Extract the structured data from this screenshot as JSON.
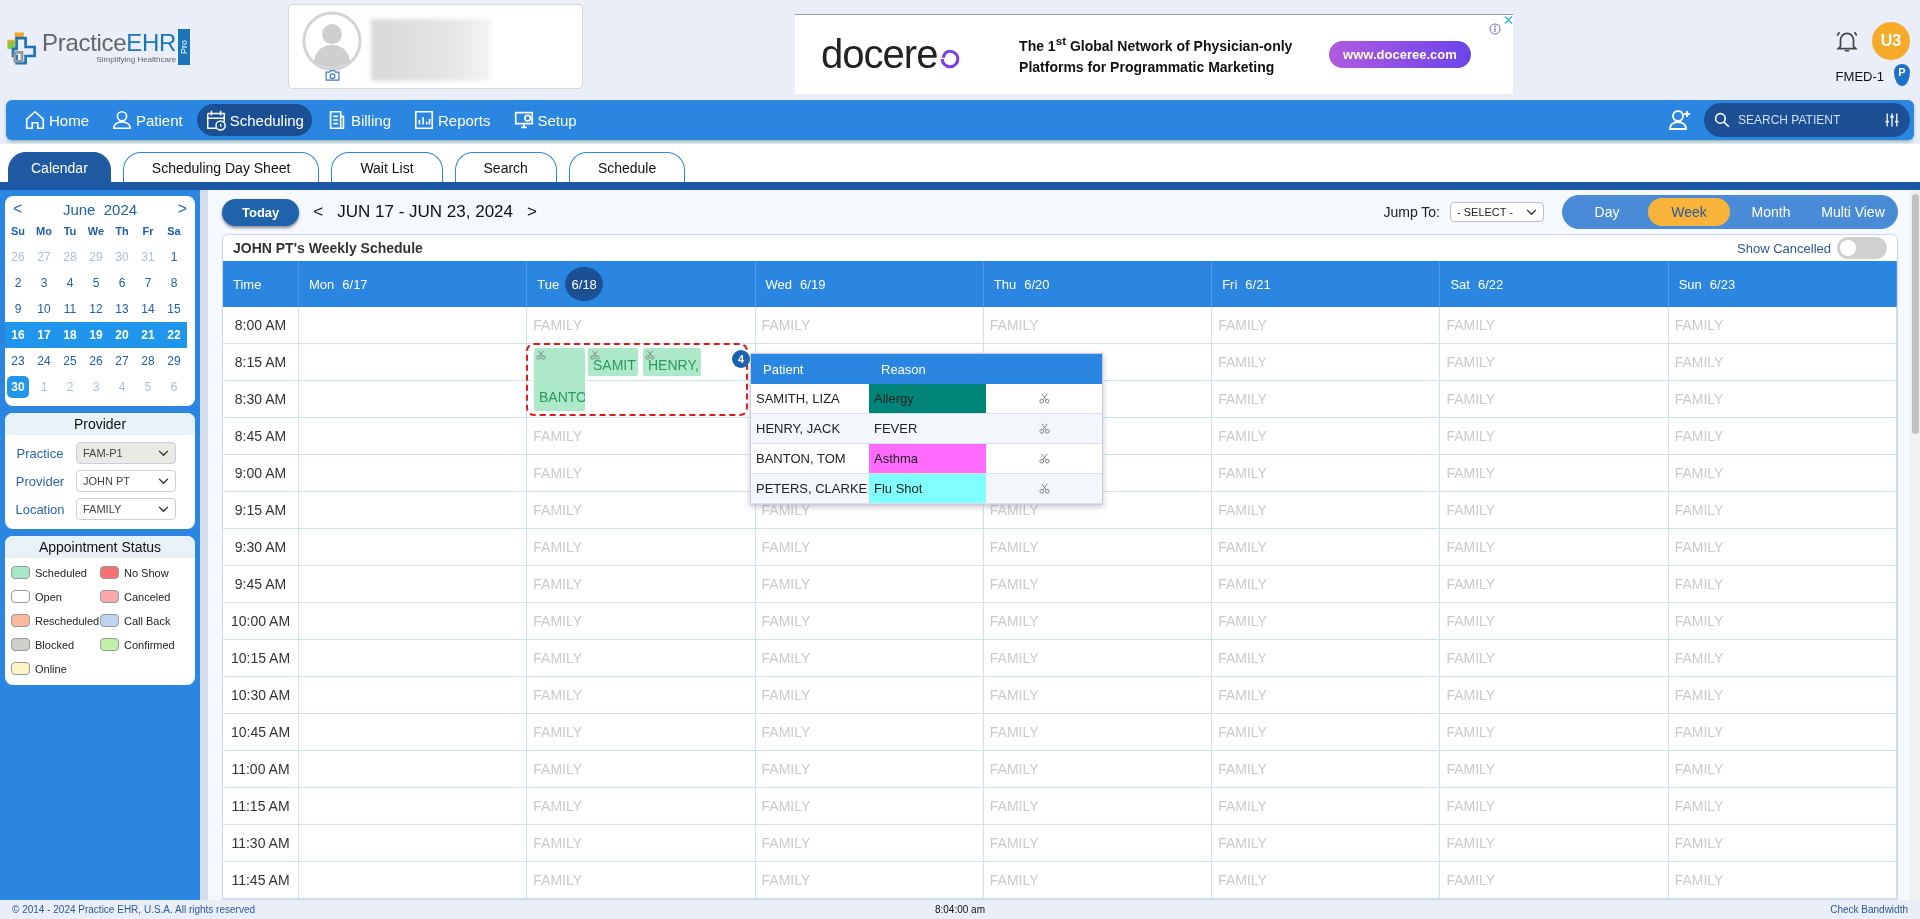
{
  "logo": {
    "name_a": "Practice",
    "name_b": "EHR",
    "tagline": "Simplifying Healthcare",
    "edition": "Pro"
  },
  "ad": {
    "brand": "docere",
    "headline": "The 1$^{st}$ Global Network of Physician-only",
    "headline2": "Platforms for Programmatic Marketing",
    "url": "www.doceree.com"
  },
  "user": {
    "initials": "U3",
    "facility": "FMED-1",
    "pin_letter": "P"
  },
  "nav": [
    {
      "label": "Home",
      "selected": false
    },
    {
      "label": "Patient",
      "selected": false
    },
    {
      "label": "Scheduling",
      "selected": true
    },
    {
      "label": "Billing",
      "selected": false
    },
    {
      "label": "Reports",
      "selected": false
    },
    {
      "label": "Setup",
      "selected": false
    }
  ],
  "search": {
    "placeholder": "SEARCH PATIENT"
  },
  "tabs": [
    {
      "label": "Calendar",
      "selected": true
    },
    {
      "label": "Scheduling Day Sheet",
      "selected": false
    },
    {
      "label": "Wait List",
      "selected": false
    },
    {
      "label": "Search",
      "selected": false
    },
    {
      "label": "Schedule",
      "selected": false
    }
  ],
  "mini_calendar": {
    "prev": "<",
    "month": "June",
    "year": "2024",
    "next": ">",
    "weekdays": [
      "Su",
      "Mo",
      "Tu",
      "We",
      "Th",
      "Fr",
      "Sa"
    ],
    "weeks": [
      {
        "selected": false,
        "days": [
          {
            "d": "26",
            "muted": true,
            "selected": false
          },
          {
            "d": "27",
            "muted": true,
            "selected": false
          },
          {
            "d": "28",
            "muted": true,
            "selected": false
          },
          {
            "d": "29",
            "muted": true,
            "selected": false
          },
          {
            "d": "30",
            "muted": true,
            "selected": false
          },
          {
            "d": "31",
            "muted": true,
            "selected": false
          },
          {
            "d": "1",
            "muted": false,
            "selected": false
          }
        ]
      },
      {
        "selected": false,
        "days": [
          {
            "d": "2",
            "muted": false,
            "selected": false
          },
          {
            "d": "3",
            "muted": false,
            "selected": false
          },
          {
            "d": "4",
            "muted": false,
            "selected": false
          },
          {
            "d": "5",
            "muted": false,
            "selected": false
          },
          {
            "d": "6",
            "muted": false,
            "selected": false
          },
          {
            "d": "7",
            "muted": false,
            "selected": false
          },
          {
            "d": "8",
            "muted": false,
            "selected": false
          }
        ]
      },
      {
        "selected": false,
        "days": [
          {
            "d": "9",
            "muted": false,
            "selected": false
          },
          {
            "d": "10",
            "muted": false,
            "selected": false
          },
          {
            "d": "11",
            "muted": false,
            "selected": false
          },
          {
            "d": "12",
            "muted": false,
            "selected": false
          },
          {
            "d": "13",
            "muted": false,
            "selected": false
          },
          {
            "d": "14",
            "muted": false,
            "selected": false
          },
          {
            "d": "15",
            "muted": false,
            "selected": false
          }
        ]
      },
      {
        "selected": true,
        "days": [
          {
            "d": "16",
            "muted": false,
            "selected": false
          },
          {
            "d": "17",
            "muted": false,
            "selected": false
          },
          {
            "d": "18",
            "muted": false,
            "selected": false
          },
          {
            "d": "19",
            "muted": false,
            "selected": false
          },
          {
            "d": "20",
            "muted": false,
            "selected": false
          },
          {
            "d": "21",
            "muted": false,
            "selected": false
          },
          {
            "d": "22",
            "muted": false,
            "selected": false
          }
        ]
      },
      {
        "selected": false,
        "days": [
          {
            "d": "23",
            "muted": false,
            "selected": false
          },
          {
            "d": "24",
            "muted": false,
            "selected": false
          },
          {
            "d": "25",
            "muted": false,
            "selected": false
          },
          {
            "d": "26",
            "muted": false,
            "selected": false
          },
          {
            "d": "27",
            "muted": false,
            "selected": false
          },
          {
            "d": "28",
            "muted": false,
            "selected": false
          },
          {
            "d": "29",
            "muted": false,
            "selected": false
          }
        ]
      },
      {
        "selected": false,
        "days": [
          {
            "d": "30",
            "muted": false,
            "selected": true
          },
          {
            "d": "1",
            "muted": true,
            "selected": false
          },
          {
            "d": "2",
            "muted": true,
            "selected": false
          },
          {
            "d": "3",
            "muted": true,
            "selected": false
          },
          {
            "d": "4",
            "muted": true,
            "selected": false
          },
          {
            "d": "5",
            "muted": true,
            "selected": false
          },
          {
            "d": "6",
            "muted": true,
            "selected": false
          }
        ]
      }
    ]
  },
  "provider_panel": {
    "title": "Provider",
    "fields": [
      {
        "label": "Practice",
        "value": "FAM-P1",
        "disabled": true
      },
      {
        "label": "Provider",
        "value": "JOHN PT",
        "disabled": false
      },
      {
        "label": "Location",
        "value": "FAMILY",
        "disabled": false
      }
    ]
  },
  "status_panel": {
    "title": "Appointment Status",
    "items": [
      {
        "label": "Scheduled",
        "color": "#a8e6c8"
      },
      {
        "label": "No Show",
        "color": "#f87171"
      },
      {
        "label": "Open",
        "color": "#ffffff"
      },
      {
        "label": "Canceled",
        "color": "#f9a8ac"
      },
      {
        "label": "Rescheduled",
        "color": "#fbb89a"
      },
      {
        "label": "Call Back",
        "color": "#bcd6f2"
      },
      {
        "label": "Blocked",
        "color": "#cfcfcb"
      },
      {
        "label": "Confirmed",
        "color": "#bff2a8"
      },
      {
        "label": "Online",
        "color": "#fff4c4"
      }
    ]
  },
  "toolbar": {
    "today": "Today",
    "prev": "<",
    "range": "JUN 17 - JUN 23, 2024",
    "next": ">",
    "jump_label": "Jump To:",
    "jump_value": "- SELECT -",
    "views": [
      {
        "label": "Day",
        "selected": false
      },
      {
        "label": "Week",
        "selected": true
      },
      {
        "label": "Month",
        "selected": false
      },
      {
        "label": "Multi View",
        "selected": false
      }
    ]
  },
  "schedule": {
    "title": "JOHN PT's Weekly Schedule",
    "show_cancelled": {
      "label": "Show Cancelled",
      "on": false
    },
    "columns": [
      {
        "day": "Time"
      },
      {
        "day": "Mon",
        "date": "6/17",
        "marked": false
      },
      {
        "day": "Tue",
        "date": "6/18",
        "marked": true
      },
      {
        "day": "Wed",
        "date": "6/19",
        "marked": false
      },
      {
        "day": "Thu",
        "date": "6/20",
        "marked": false
      },
      {
        "day": "Fri",
        "date": "6/21",
        "marked": false
      },
      {
        "day": "Sat",
        "date": "6/22",
        "marked": false
      },
      {
        "day": "Sun",
        "date": "6/23",
        "marked": false
      }
    ],
    "rows": [
      {
        "cells": [
          "8:00 AM",
          "",
          "FAMILY",
          "FAMILY",
          "FAMILY",
          "FAMILY",
          "FAMILY",
          "FAMILY"
        ]
      },
      {
        "cells": [
          "8:15 AM",
          "",
          "",
          "",
          "",
          "FAMILY",
          "FAMILY",
          "FAMILY"
        ]
      },
      {
        "cells": [
          "8:30 AM",
          "",
          "",
          "",
          "",
          "FAMILY",
          "FAMILY",
          "FAMILY"
        ]
      },
      {
        "cells": [
          "8:45 AM",
          "",
          "FAMILY",
          "",
          "",
          "FAMILY",
          "FAMILY",
          "FAMILY"
        ]
      },
      {
        "cells": [
          "9:00 AM",
          "",
          "FAMILY",
          "",
          "",
          "FAMILY",
          "FAMILY",
          "FAMILY"
        ]
      },
      {
        "cells": [
          "9:15 AM",
          "",
          "FAMILY",
          "FAMILY",
          "FAMILY",
          "FAMILY",
          "FAMILY",
          "FAMILY"
        ]
      },
      {
        "cells": [
          "9:30 AM",
          "",
          "FAMILY",
          "FAMILY",
          "FAMILY",
          "FAMILY",
          "FAMILY",
          "FAMILY"
        ]
      },
      {
        "cells": [
          "9:45 AM",
          "",
          "FAMILY",
          "FAMILY",
          "FAMILY",
          "FAMILY",
          "FAMILY",
          "FAMILY"
        ]
      },
      {
        "cells": [
          "10:00 AM",
          "",
          "FAMILY",
          "FAMILY",
          "FAMILY",
          "FAMILY",
          "FAMILY",
          "FAMILY"
        ]
      },
      {
        "cells": [
          "10:15 AM",
          "",
          "FAMILY",
          "FAMILY",
          "FAMILY",
          "FAMILY",
          "FAMILY",
          "FAMILY"
        ]
      },
      {
        "cells": [
          "10:30 AM",
          "",
          "FAMILY",
          "FAMILY",
          "FAMILY",
          "FAMILY",
          "FAMILY",
          "FAMILY"
        ]
      },
      {
        "cells": [
          "10:45 AM",
          "",
          "FAMILY",
          "FAMILY",
          "FAMILY",
          "FAMILY",
          "FAMILY",
          "FAMILY"
        ]
      },
      {
        "cells": [
          "11:00 AM",
          "",
          "FAMILY",
          "FAMILY",
          "FAMILY",
          "FAMILY",
          "FAMILY",
          "FAMILY"
        ]
      },
      {
        "cells": [
          "11:15 AM",
          "",
          "FAMILY",
          "FAMILY",
          "FAMILY",
          "FAMILY",
          "FAMILY",
          "FAMILY"
        ]
      },
      {
        "cells": [
          "11:30 AM",
          "",
          "FAMILY",
          "FAMILY",
          "FAMILY",
          "FAMILY",
          "FAMILY",
          "FAMILY"
        ]
      },
      {
        "cells": [
          "11:45 AM",
          "",
          "FAMILY",
          "FAMILY",
          "FAMILY",
          "FAMILY",
          "FAMILY",
          "FAMILY"
        ]
      }
    ],
    "appointments": [
      {
        "name": "BANTO",
        "kind": "tall",
        "color": "#ade8c9"
      },
      {
        "name": "SAMIT",
        "kind": "short",
        "color": "#ade8c9"
      },
      {
        "name": "HENRY,",
        "kind": "short",
        "color": "#ade8c9"
      }
    ],
    "overflow_count": "4",
    "popover": {
      "columns": [
        "Patient",
        "Reason"
      ],
      "rows": [
        {
          "patient": "SAMITH,  LIZA",
          "reason": "Allergy",
          "color": "#008578"
        },
        {
          "patient": "HENRY, JACK",
          "reason": "FEVER",
          "color": null
        },
        {
          "patient": "BANTON, TOM",
          "reason": "Asthma",
          "color": "#ff6bff"
        },
        {
          "patient": "PETERS, CLARKE",
          "reason": "Flu Shot",
          "color": "#80ffff"
        }
      ]
    }
  },
  "footer": {
    "copyright": "© 2014 - 2024 Practice EHR, U.S.A. All rights reserved",
    "time": "8:04:00 am",
    "link": "Check Bandwidth"
  }
}
